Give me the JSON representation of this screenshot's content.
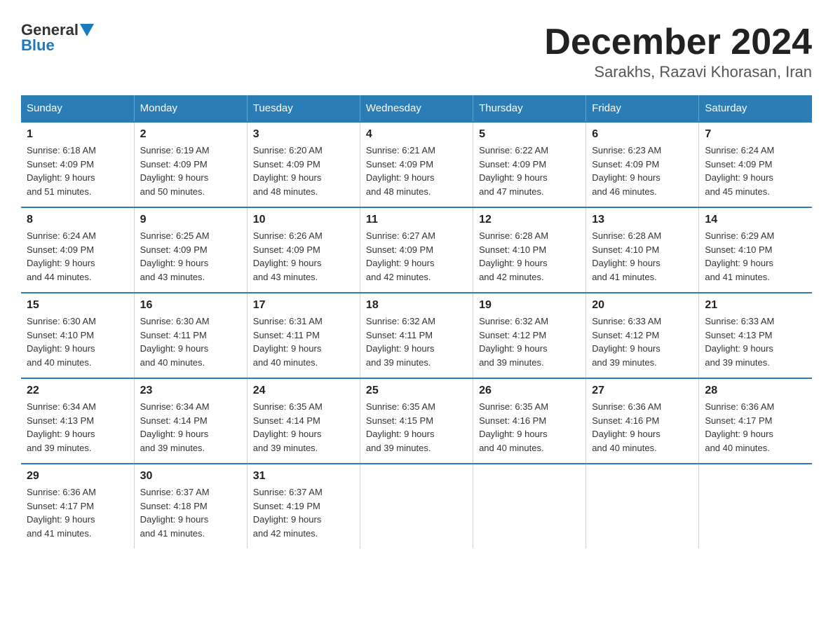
{
  "logo": {
    "general": "General",
    "blue": "Blue"
  },
  "title": {
    "month": "December 2024",
    "location": "Sarakhs, Razavi Khorasan, Iran"
  },
  "weekdays": [
    "Sunday",
    "Monday",
    "Tuesday",
    "Wednesday",
    "Thursday",
    "Friday",
    "Saturday"
  ],
  "weeks": [
    [
      {
        "day": "1",
        "sunrise": "6:18 AM",
        "sunset": "4:09 PM",
        "daylight": "9 hours and 51 minutes."
      },
      {
        "day": "2",
        "sunrise": "6:19 AM",
        "sunset": "4:09 PM",
        "daylight": "9 hours and 50 minutes."
      },
      {
        "day": "3",
        "sunrise": "6:20 AM",
        "sunset": "4:09 PM",
        "daylight": "9 hours and 48 minutes."
      },
      {
        "day": "4",
        "sunrise": "6:21 AM",
        "sunset": "4:09 PM",
        "daylight": "9 hours and 48 minutes."
      },
      {
        "day": "5",
        "sunrise": "6:22 AM",
        "sunset": "4:09 PM",
        "daylight": "9 hours and 47 minutes."
      },
      {
        "day": "6",
        "sunrise": "6:23 AM",
        "sunset": "4:09 PM",
        "daylight": "9 hours and 46 minutes."
      },
      {
        "day": "7",
        "sunrise": "6:24 AM",
        "sunset": "4:09 PM",
        "daylight": "9 hours and 45 minutes."
      }
    ],
    [
      {
        "day": "8",
        "sunrise": "6:24 AM",
        "sunset": "4:09 PM",
        "daylight": "9 hours and 44 minutes."
      },
      {
        "day": "9",
        "sunrise": "6:25 AM",
        "sunset": "4:09 PM",
        "daylight": "9 hours and 43 minutes."
      },
      {
        "day": "10",
        "sunrise": "6:26 AM",
        "sunset": "4:09 PM",
        "daylight": "9 hours and 43 minutes."
      },
      {
        "day": "11",
        "sunrise": "6:27 AM",
        "sunset": "4:09 PM",
        "daylight": "9 hours and 42 minutes."
      },
      {
        "day": "12",
        "sunrise": "6:28 AM",
        "sunset": "4:10 PM",
        "daylight": "9 hours and 42 minutes."
      },
      {
        "day": "13",
        "sunrise": "6:28 AM",
        "sunset": "4:10 PM",
        "daylight": "9 hours and 41 minutes."
      },
      {
        "day": "14",
        "sunrise": "6:29 AM",
        "sunset": "4:10 PM",
        "daylight": "9 hours and 41 minutes."
      }
    ],
    [
      {
        "day": "15",
        "sunrise": "6:30 AM",
        "sunset": "4:10 PM",
        "daylight": "9 hours and 40 minutes."
      },
      {
        "day": "16",
        "sunrise": "6:30 AM",
        "sunset": "4:11 PM",
        "daylight": "9 hours and 40 minutes."
      },
      {
        "day": "17",
        "sunrise": "6:31 AM",
        "sunset": "4:11 PM",
        "daylight": "9 hours and 40 minutes."
      },
      {
        "day": "18",
        "sunrise": "6:32 AM",
        "sunset": "4:11 PM",
        "daylight": "9 hours and 39 minutes."
      },
      {
        "day": "19",
        "sunrise": "6:32 AM",
        "sunset": "4:12 PM",
        "daylight": "9 hours and 39 minutes."
      },
      {
        "day": "20",
        "sunrise": "6:33 AM",
        "sunset": "4:12 PM",
        "daylight": "9 hours and 39 minutes."
      },
      {
        "day": "21",
        "sunrise": "6:33 AM",
        "sunset": "4:13 PM",
        "daylight": "9 hours and 39 minutes."
      }
    ],
    [
      {
        "day": "22",
        "sunrise": "6:34 AM",
        "sunset": "4:13 PM",
        "daylight": "9 hours and 39 minutes."
      },
      {
        "day": "23",
        "sunrise": "6:34 AM",
        "sunset": "4:14 PM",
        "daylight": "9 hours and 39 minutes."
      },
      {
        "day": "24",
        "sunrise": "6:35 AM",
        "sunset": "4:14 PM",
        "daylight": "9 hours and 39 minutes."
      },
      {
        "day": "25",
        "sunrise": "6:35 AM",
        "sunset": "4:15 PM",
        "daylight": "9 hours and 39 minutes."
      },
      {
        "day": "26",
        "sunrise": "6:35 AM",
        "sunset": "4:16 PM",
        "daylight": "9 hours and 40 minutes."
      },
      {
        "day": "27",
        "sunrise": "6:36 AM",
        "sunset": "4:16 PM",
        "daylight": "9 hours and 40 minutes."
      },
      {
        "day": "28",
        "sunrise": "6:36 AM",
        "sunset": "4:17 PM",
        "daylight": "9 hours and 40 minutes."
      }
    ],
    [
      {
        "day": "29",
        "sunrise": "6:36 AM",
        "sunset": "4:17 PM",
        "daylight": "9 hours and 41 minutes."
      },
      {
        "day": "30",
        "sunrise": "6:37 AM",
        "sunset": "4:18 PM",
        "daylight": "9 hours and 41 minutes."
      },
      {
        "day": "31",
        "sunrise": "6:37 AM",
        "sunset": "4:19 PM",
        "daylight": "9 hours and 42 minutes."
      },
      null,
      null,
      null,
      null
    ]
  ],
  "labels": {
    "sunrise": "Sunrise:",
    "sunset": "Sunset:",
    "daylight": "Daylight:"
  }
}
